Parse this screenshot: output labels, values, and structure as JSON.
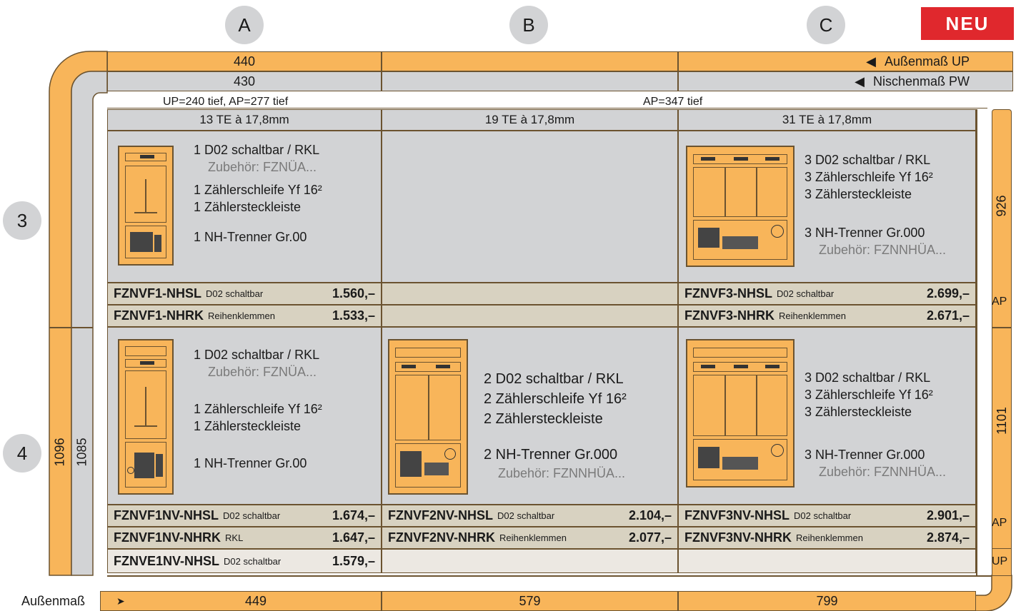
{
  "badge": "NEU",
  "columns": [
    {
      "letter": "A",
      "te": "13 TE à 17,8mm",
      "outer_up": "440",
      "niche_pw": "430",
      "outer_width": "449"
    },
    {
      "letter": "B",
      "te": "19 TE à 17,8mm",
      "outer_up": "",
      "niche_pw": "",
      "outer_width": "579"
    },
    {
      "letter": "C",
      "te": "31 TE à 17,8mm",
      "outer_up": "",
      "niche_pw": "",
      "outer_width": "799"
    }
  ],
  "legend": {
    "outer_up": "Außenmaß  UP",
    "niche_pw": "Nischenmaß PW",
    "bottom_label": "Außenmaß"
  },
  "depth": {
    "a": "UP=240 tief, AP=277 tief",
    "bc": "AP=347 tief"
  },
  "rows": [
    {
      "number": "3",
      "height_right": "926"
    },
    {
      "number": "4",
      "height_right": "1101"
    }
  ],
  "left_heights": {
    "outer": "1096",
    "niche": "1085"
  },
  "side_tags": {
    "ap_row3": "AP",
    "ap_row4": "AP",
    "up_row4": "UP"
  },
  "row3": {
    "a": {
      "lines": [
        "1  D02 schaltbar / RKL",
        "Zubehör: FZNÜA...",
        "1  Zählerschleife Yf 16²",
        "1  Zählersteckleiste",
        "1  NH-Trenner Gr.00"
      ]
    },
    "c": {
      "lines": [
        "3  D02 schaltbar / RKL",
        "3  Zählerschleife Yf 16²",
        "3  Zählersteckleiste",
        "3  NH-Trenner Gr.000",
        "Zubehör: FZNNHÜA..."
      ]
    },
    "products": {
      "a": [
        {
          "code": "FZNVF1-NHSL",
          "desc": "D02 schaltbar",
          "price": "1.560,–"
        },
        {
          "code": "FZNVF1-NHRK",
          "desc": "Reihenklemmen",
          "price": "1.533,–"
        }
      ],
      "c": [
        {
          "code": "FZNVF3-NHSL",
          "desc": "D02 schaltbar",
          "price": "2.699,–"
        },
        {
          "code": "FZNVF3-NHRK",
          "desc": "Reihenklemmen",
          "price": "2.671,–"
        }
      ]
    }
  },
  "row4": {
    "a": {
      "lines": [
        "1  D02 schaltbar / RKL",
        "Zubehör: FZNÜA...",
        "1  Zählerschleife Yf 16²",
        "1  Zählersteckleiste",
        "1  NH-Trenner Gr.00"
      ]
    },
    "b": {
      "lines": [
        "2  D02 schaltbar / RKL",
        "2  Zählerschleife Yf 16²",
        "2  Zählersteckleiste",
        "2  NH-Trenner Gr.000",
        "Zubehör: FZNNHÜA..."
      ]
    },
    "c": {
      "lines": [
        "3  D02 schaltbar / RKL",
        "3  Zählerschleife Yf 16²",
        "3  Zählersteckleiste",
        "3  NH-Trenner Gr.000",
        "Zubehör: FZNNHÜA..."
      ]
    },
    "products": {
      "a": [
        {
          "code": "FZNVF1NV-NHSL",
          "desc": "D02 schaltbar",
          "price": "1.674,–"
        },
        {
          "code": "FZNVF1NV-NHRK",
          "desc": "RKL",
          "price": "1.647,–"
        },
        {
          "code": "FZNVE1NV-NHSL",
          "desc": "D02 schaltbar",
          "price": "1.579,–"
        }
      ],
      "b": [
        {
          "code": "FZNVF2NV-NHSL",
          "desc": "D02 schaltbar",
          "price": "2.104,–"
        },
        {
          "code": "FZNVF2NV-NHRK",
          "desc": "Reihenklemmen",
          "price": "2.077,–"
        }
      ],
      "c": [
        {
          "code": "FZNVF3NV-NHSL",
          "desc": "D02 schaltbar",
          "price": "2.901,–"
        },
        {
          "code": "FZNVF3NV-NHRK",
          "desc": "Reihenklemmen",
          "price": "2.874,–"
        }
      ]
    }
  }
}
